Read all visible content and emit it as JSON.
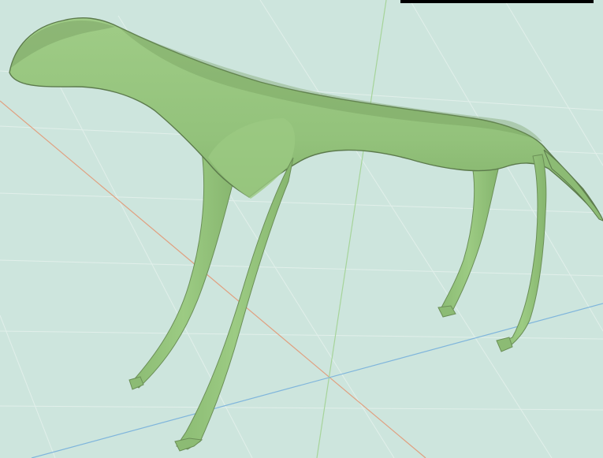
{
  "scene": {
    "kind": "3d-mesh-viewer",
    "subject": "quadruped-animal-mesh",
    "background_color": "#cde5dd",
    "grid_color": "#e8f3ef",
    "axis_colors": {
      "x": "#e0a080",
      "y": "#a6d49a",
      "z": "#7fb5dc"
    },
    "mesh_color": "#97c67e",
    "mesh_shadow_color": "#5c7a4c",
    "top_bar_color": "#000000"
  }
}
